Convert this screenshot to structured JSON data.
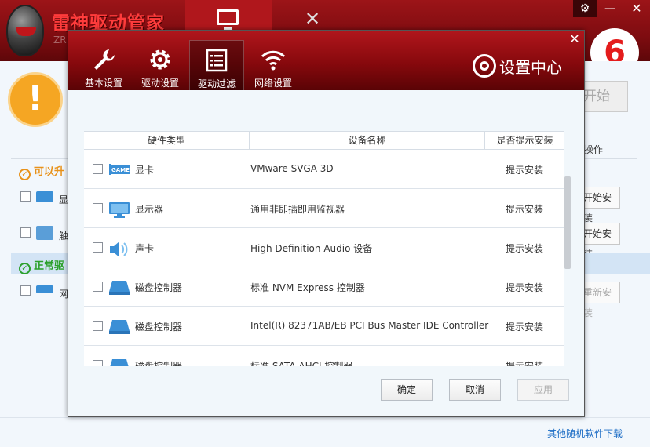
{
  "app": {
    "title": "雷神驱动管家",
    "subtitle": "ZR"
  },
  "main": {
    "start_button_partial": "开始",
    "column_operation": "操作",
    "section_upgrade": "可以升",
    "section_normal": "正常驱",
    "rows": [
      {
        "label": "显",
        "button": "开始安装"
      },
      {
        "label": "触",
        "button": "开始安装"
      },
      {
        "label": "网",
        "button": "重新安装"
      }
    ],
    "footer_link": "其他随机软件下载"
  },
  "dialog": {
    "title": "设置中心",
    "tabs": [
      {
        "label": "基本设置",
        "icon": "wrench-icon"
      },
      {
        "label": "驱动设置",
        "icon": "gear-icon"
      },
      {
        "label": "驱动过滤",
        "icon": "list-icon"
      },
      {
        "label": "网络设置",
        "icon": "wifi-icon"
      }
    ],
    "active_tab": "驱动过滤",
    "columns": {
      "type": "硬件类型",
      "name": "设备名称",
      "prompt": "是否提示安装"
    },
    "devices": [
      {
        "type": "显卡",
        "name": "VMware SVGA 3D",
        "prompt": "提示安装",
        "icon": "graphics-card-icon"
      },
      {
        "type": "显示器",
        "name": "通用非即插即用监视器",
        "prompt": "提示安装",
        "icon": "monitor-icon"
      },
      {
        "type": "声卡",
        "name": "High Definition Audio 设备",
        "prompt": "提示安装",
        "icon": "speaker-icon"
      },
      {
        "type": "磁盘控制器",
        "name": "标准 NVM Express 控制器",
        "prompt": "提示安装",
        "icon": "disk-controller-icon"
      },
      {
        "type": "磁盘控制器",
        "name": "Intel(R) 82371AB/EB PCI Bus Master IDE Controller",
        "prompt": "提示安装",
        "icon": "disk-controller-icon"
      },
      {
        "type": "磁盘控制器",
        "name": "标准 SATA AHCI 控制器",
        "prompt": "提示安装",
        "icon": "disk-controller-icon"
      }
    ],
    "buttons": {
      "ok": "确定",
      "cancel": "取消",
      "apply": "应用"
    }
  },
  "colors": {
    "header_red": "#8b0e12",
    "accent_blue": "#3a8fd6",
    "warning_orange": "#f5a623",
    "success_green": "#2ba02b",
    "link_blue": "#1a6bc4"
  }
}
